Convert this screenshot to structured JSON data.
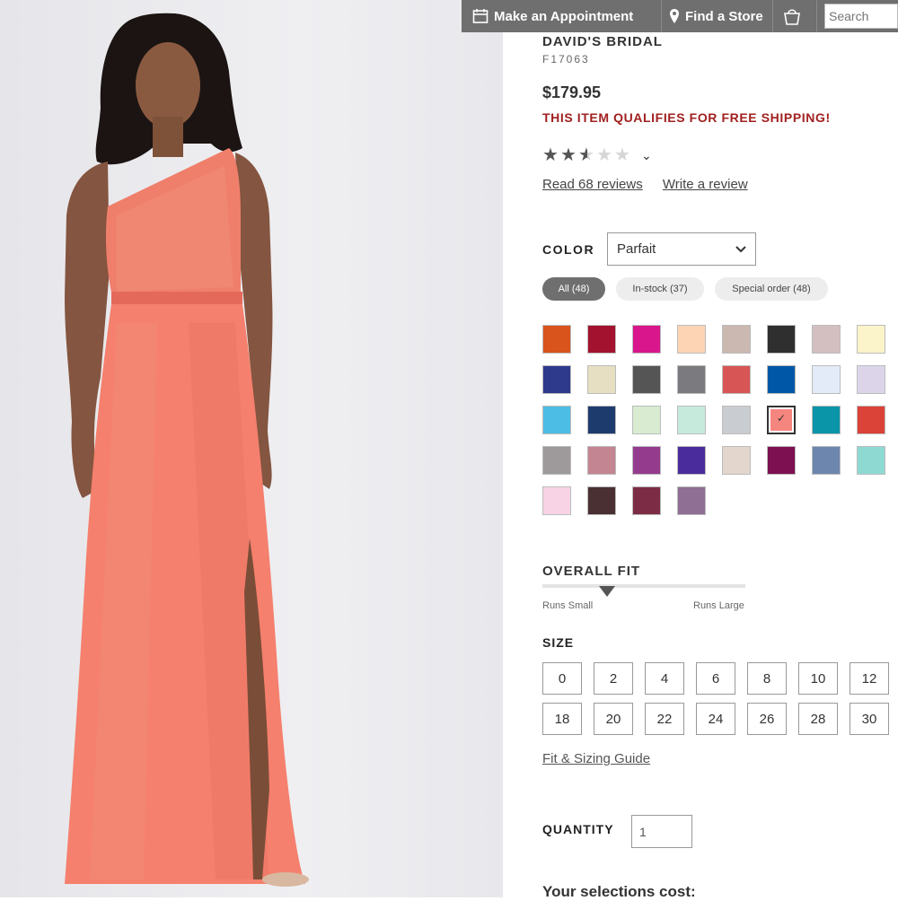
{
  "topbar": {
    "appointment_label": "Make an Appointment",
    "store_label": "Find a Store",
    "search_placeholder": "Search"
  },
  "product": {
    "brand": "DAVID'S BRIDAL",
    "sku": "F17063",
    "price": "$179.95",
    "shipping_note": "THIS ITEM QUALIFIES FOR FREE SHIPPING!",
    "rating_stars": 2.5,
    "rating_max": 5,
    "read_reviews": "Read 68 reviews",
    "write_review": "Write a review"
  },
  "color": {
    "label": "COLOR",
    "selected": "Parfait",
    "filters": [
      {
        "label": "All (48)",
        "active": true
      },
      {
        "label": "In-stock (37)",
        "active": false
      },
      {
        "label": "Special order (48)",
        "active": false
      }
    ],
    "swatches": [
      "#d9531c",
      "#a3122f",
      "#d9168c",
      "#fdd5b4",
      "#cbb8b0",
      "#2f2f2f",
      "#d4bfc0",
      "#fbf3c9",
      "#2e3a8c",
      "#e6dfc2",
      "#555555",
      "#7a7a7f",
      "#d85555",
      "#0057a8",
      "#e2ebf7",
      "#dcd5ea",
      "#4cbde4",
      "#1e3b6e",
      "#d9ecd2",
      "#c6eadb",
      "#c9ccd0",
      "#f5857f",
      "#0a95a8",
      "#db4238",
      "#9e9a9c",
      "#c48592",
      "#953b8e",
      "#4a2c9c",
      "#e2d6cd",
      "#7d1050",
      "#6d86ad",
      "#8fd9d3",
      "#f8d3e5",
      "#4a3033",
      "#7c2d45",
      "#8f6f94"
    ],
    "selected_index": 21
  },
  "fit": {
    "label": "OVERALL FIT",
    "small_label": "Runs Small",
    "large_label": "Runs Large",
    "value": 0.32
  },
  "size": {
    "label": "SIZE",
    "options": [
      "0",
      "2",
      "4",
      "6",
      "8",
      "10",
      "12",
      "18",
      "20",
      "22",
      "24",
      "26",
      "28",
      "30"
    ],
    "guide_label": "Fit & Sizing Guide"
  },
  "quantity": {
    "label": "QUANTITY",
    "value": "1"
  },
  "cost_label": "Your selections cost:"
}
